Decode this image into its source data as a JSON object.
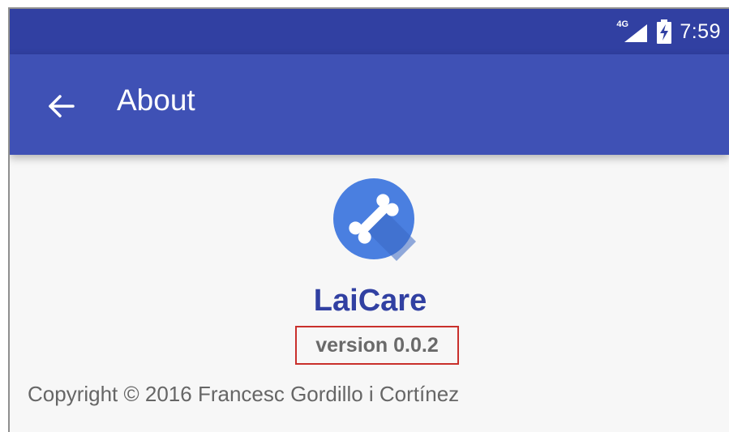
{
  "status_bar": {
    "network_label": "4G",
    "time": "7:59",
    "icons": [
      "signal-icon",
      "battery-charging-icon"
    ]
  },
  "app_bar": {
    "title": "About",
    "back_icon": "arrow-back-icon"
  },
  "about": {
    "app_name": "LaiCare",
    "version": "version 0.0.2",
    "copyright": "Copyright © 2016 Francesc Gordillo i Cortínez",
    "logo_icon": "bone-icon"
  },
  "colors": {
    "status_bar": "#3140a2",
    "app_bar": "#3f51b5",
    "logo_circle": "#4a7fe0",
    "app_name": "#3140a2",
    "highlight_box": "#c9302c",
    "background": "#f7f7f7"
  }
}
